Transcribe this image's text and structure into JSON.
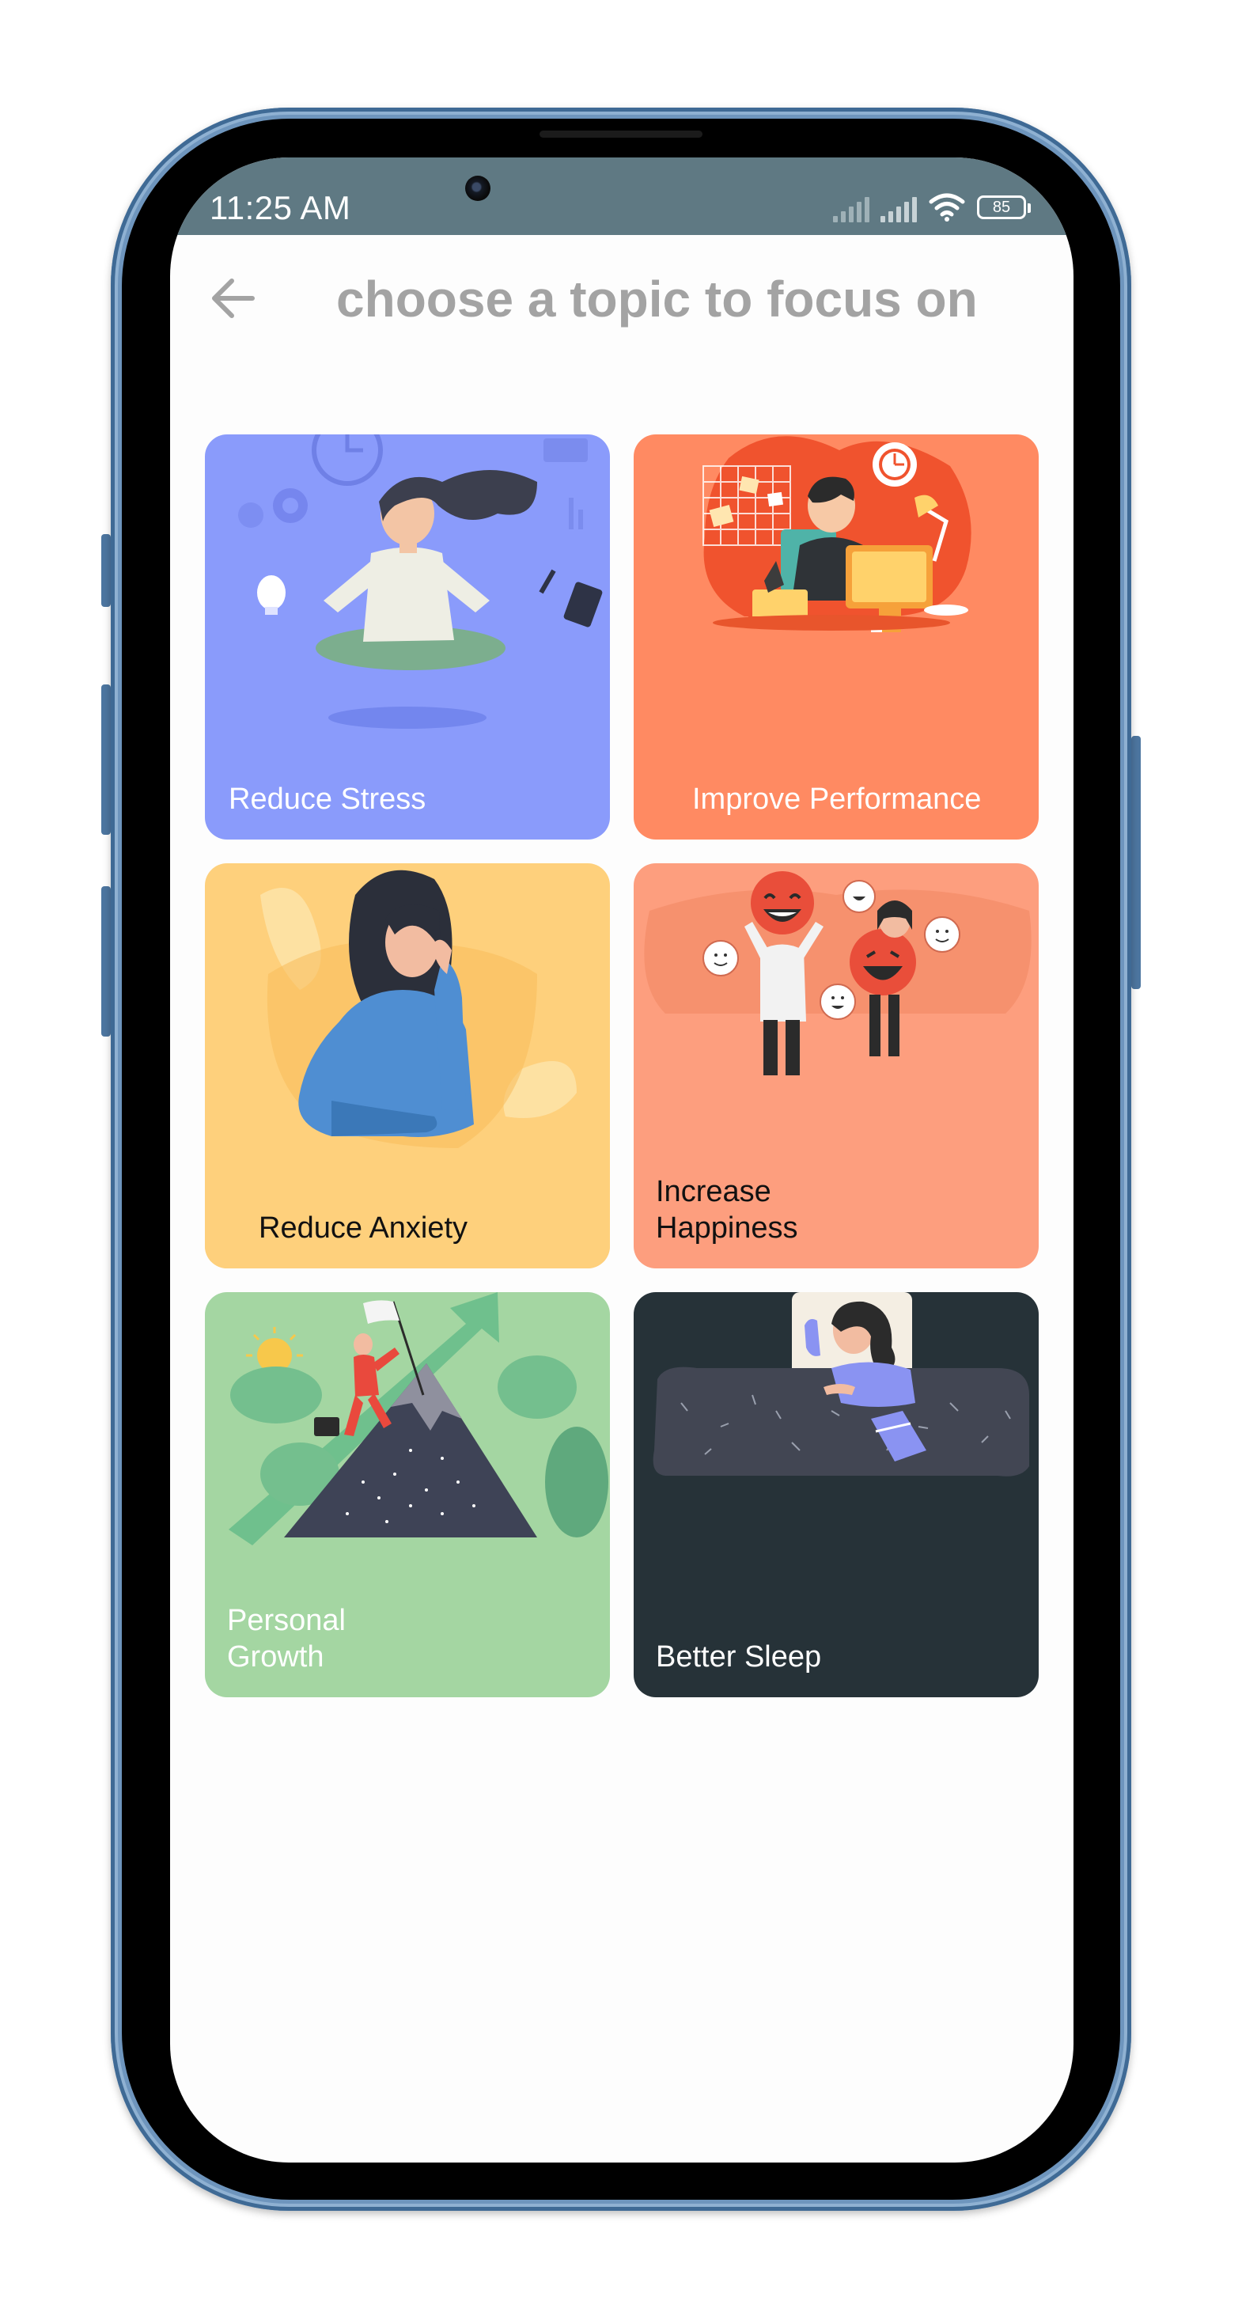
{
  "status_bar": {
    "time": "11:25 AM",
    "battery": "85",
    "icons": [
      "signal-icon",
      "signal-icon",
      "wifi-icon",
      "battery-icon"
    ]
  },
  "header": {
    "back_icon": "arrow-left-icon",
    "title": "choose a topic to focus on"
  },
  "topics": [
    {
      "label": "Reduce Stress",
      "color": "#8a9bfb",
      "text_color": "#ffffff",
      "illustration": "meditating-woman-illustration"
    },
    {
      "label": "Improve Performance",
      "color": "#ff8a62",
      "text_color": "#ffffff",
      "illustration": "man-at-desk-illustration"
    },
    {
      "label": "Reduce Anxiety",
      "color": "#fed07c",
      "text_color": "#111111",
      "illustration": "anxious-woman-illustration"
    },
    {
      "label": "Increase\nHappiness",
      "color": "#fd9e7e",
      "text_color": "#111111",
      "illustration": "happy-people-illustration"
    },
    {
      "label": "Personal\nGrowth",
      "color": "#a4d6a2",
      "text_color": "#ffffff",
      "illustration": "mountain-climber-illustration"
    },
    {
      "label": "Better Sleep",
      "color": "#263238",
      "text_color": "#ffffff",
      "illustration": "sleeping-woman-illustration"
    }
  ]
}
